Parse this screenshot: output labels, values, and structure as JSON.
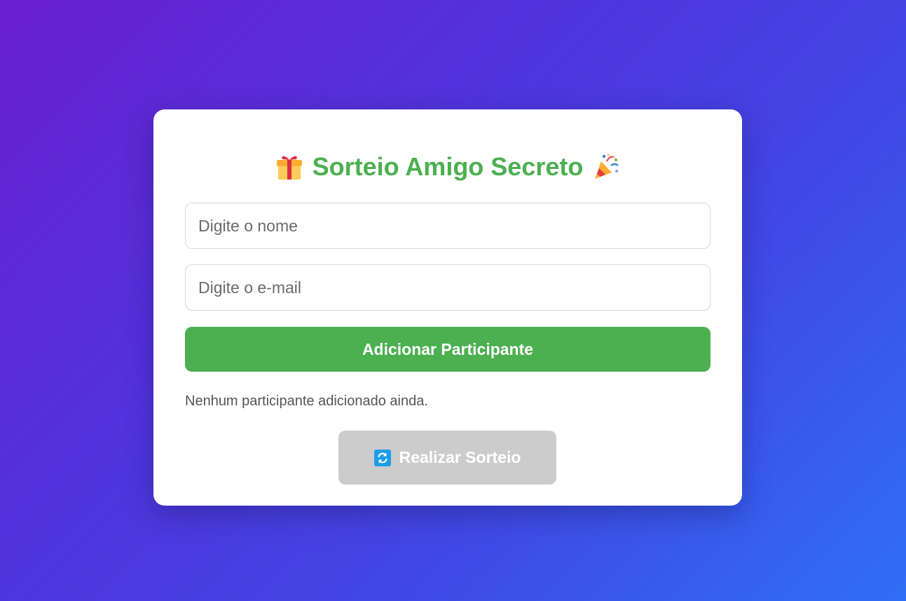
{
  "card": {
    "title": "Sorteio Amigo Secreto",
    "title_left_icon": "gift-icon",
    "title_right_icon": "party-popper-icon"
  },
  "form": {
    "name_placeholder": "Digite o nome",
    "name_value": "",
    "email_placeholder": "Digite o e-mail",
    "email_value": "",
    "add_button_label": "Adicionar Participante"
  },
  "participants": {
    "empty_message": "Nenhum participante adicionado ainda.",
    "items": []
  },
  "draw": {
    "button_label": "Realizar Sorteio",
    "button_icon": "refresh-icon",
    "disabled": true
  },
  "colors": {
    "accent": "#4caf50",
    "disabled": "#cccccc",
    "gradient_start": "#6a1fd1",
    "gradient_end": "#2f6ff5"
  }
}
